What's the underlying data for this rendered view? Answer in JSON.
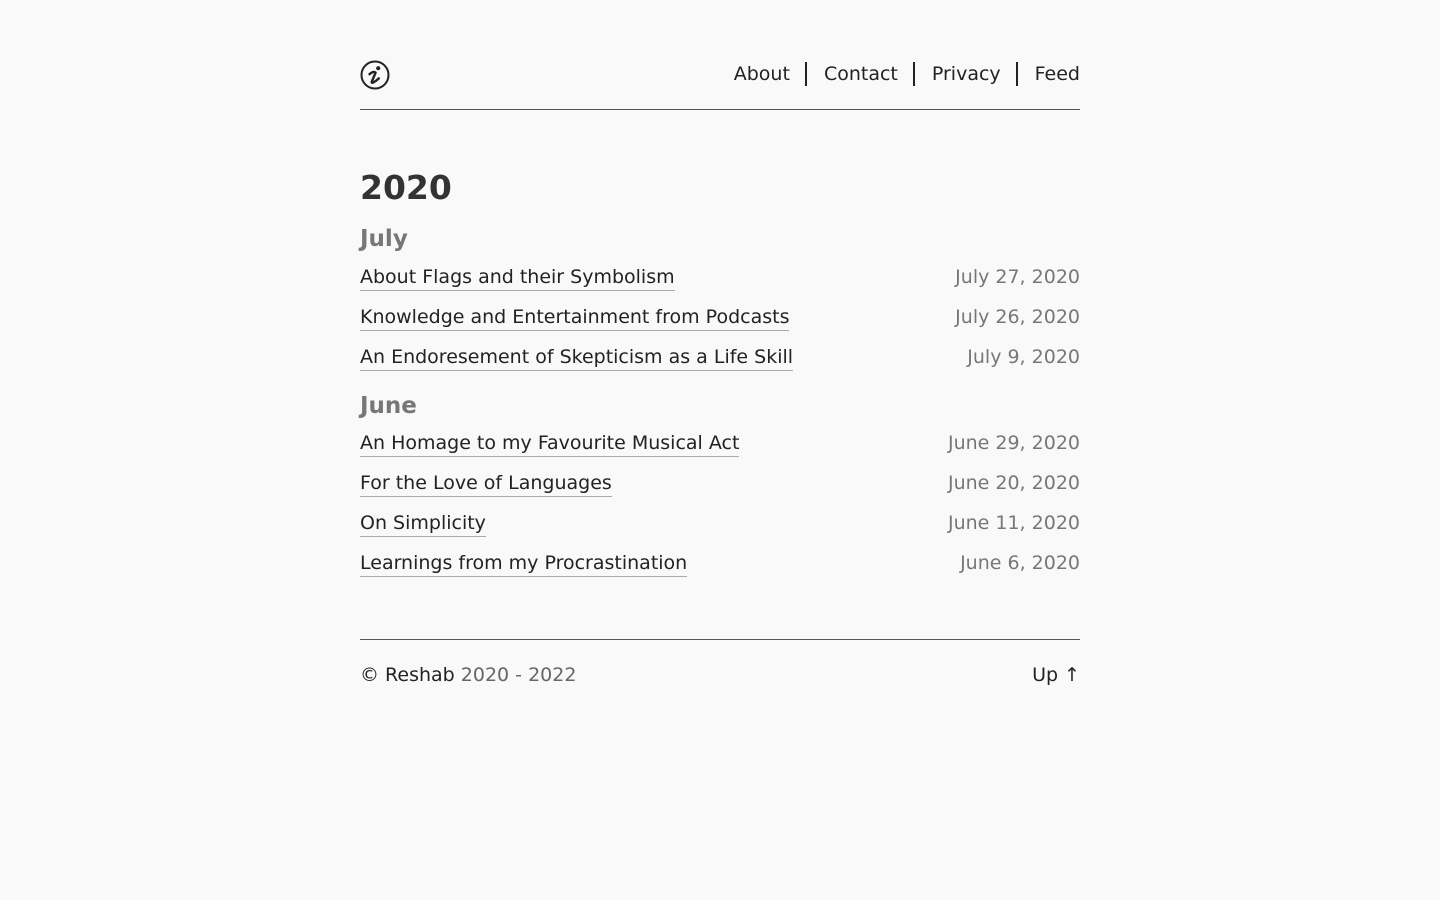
{
  "nav": {
    "logo_icon": "circled-i-logo-icon",
    "items": [
      {
        "label": "About"
      },
      {
        "label": "Contact"
      },
      {
        "label": "Privacy"
      },
      {
        "label": "Feed"
      }
    ]
  },
  "archive": {
    "year": "2020",
    "months": [
      {
        "name": "July",
        "posts": [
          {
            "title": "About Flags and their Symbolism",
            "date": "July 27, 2020"
          },
          {
            "title": "Knowledge and Entertainment from Podcasts",
            "date": "July 26, 2020"
          },
          {
            "title": "An Endoresement of Skepticism as a Life Skill",
            "date": "July 9, 2020"
          }
        ]
      },
      {
        "name": "June",
        "posts": [
          {
            "title": "An Homage to my Favourite Musical Act",
            "date": "June 29, 2020"
          },
          {
            "title": "For the Love of Languages",
            "date": "June 20, 2020"
          },
          {
            "title": "On Simplicity",
            "date": "June 11, 2020"
          },
          {
            "title": "Learnings from my Procrastination",
            "date": "June 6, 2020"
          }
        ]
      }
    ]
  },
  "footer": {
    "copyright_owner": "© Reshab",
    "years": "2020 - 2022",
    "up_label": "Up ↑"
  },
  "colors": {
    "background": "#f9f9f9",
    "text": "#222222",
    "muted": "#777777"
  }
}
